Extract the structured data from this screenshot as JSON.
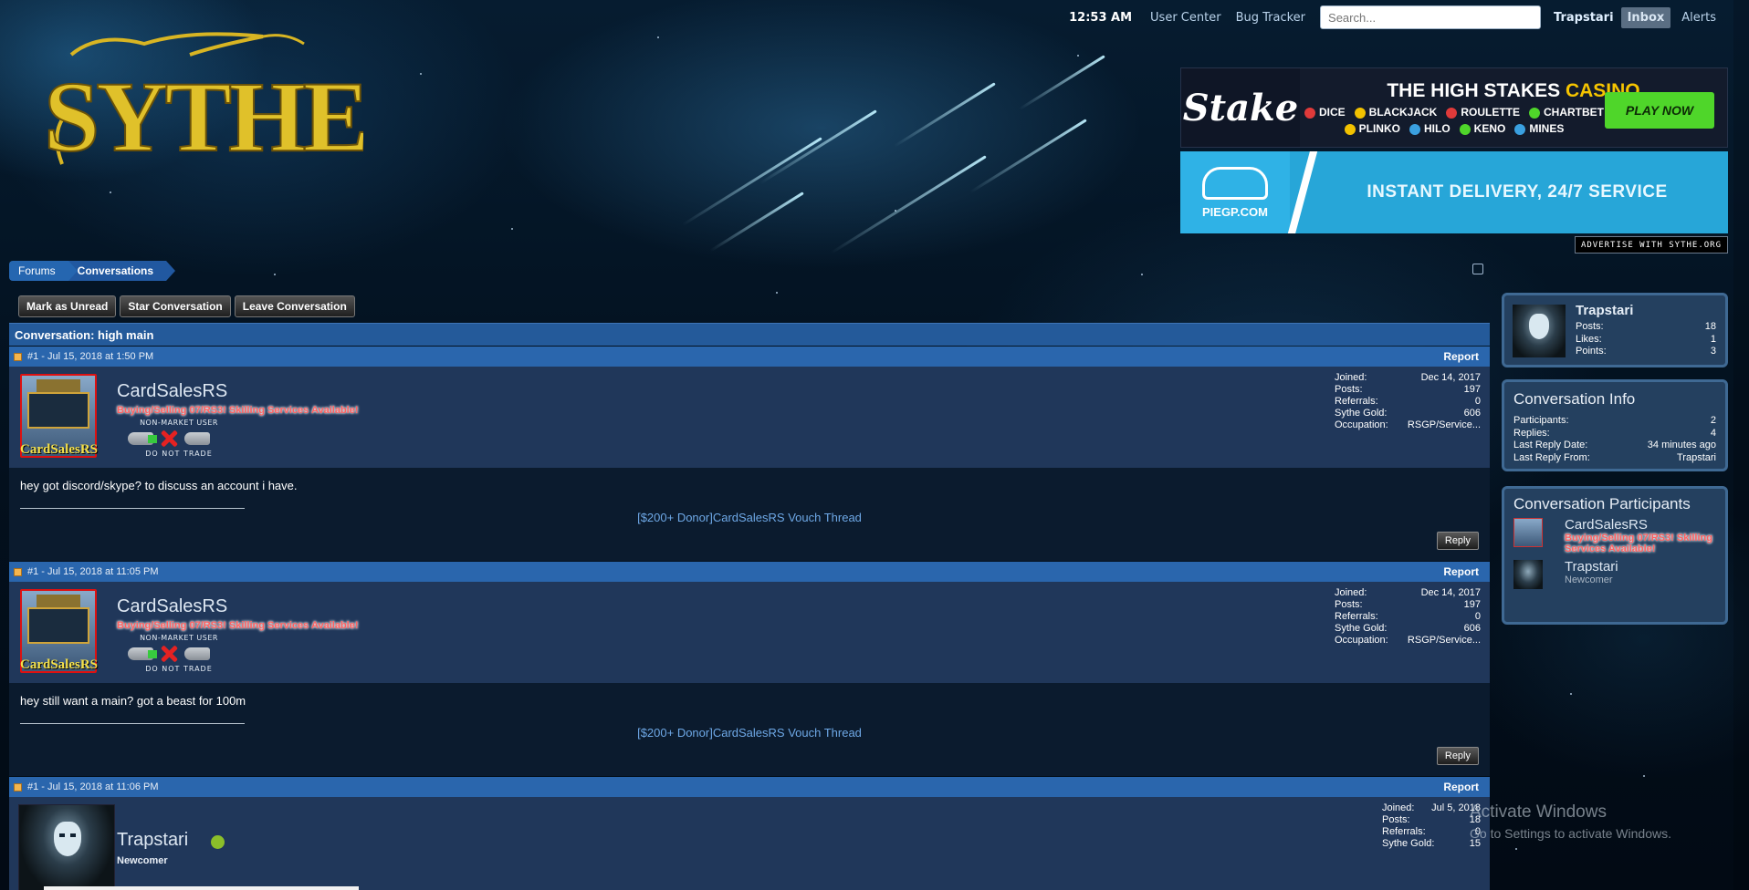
{
  "topnav": {
    "time": "12:53 AM",
    "user_center": "User Center",
    "bug_tracker": "Bug Tracker",
    "search_placeholder": "Search...",
    "username": "Trapstari",
    "inbox": "Inbox",
    "alerts": "Alerts"
  },
  "logo": {
    "text": "SYTHE",
    "color": "#e0c12a"
  },
  "ads": {
    "stake": {
      "brand": "Stake",
      "title_white": "THE HIGH STAKES",
      "title_gold": "CASINO",
      "games_row1": [
        "DICE",
        "BLACKJACK",
        "ROULETTE",
        "CHARTBET"
      ],
      "games_row2": [
        "PLINKO",
        "HILO",
        "KENO",
        "MINES"
      ],
      "cta": "PLAY NOW",
      "cta_color": "#4fd62a"
    },
    "piegp": {
      "brand": "PIEGP.COM",
      "tagline": "INSTANT DELIVERY, 24/7 SERVICE",
      "color": "#27a6d8"
    },
    "advertise": "ADVERTISE WITH SYTHE.ORG"
  },
  "breadcrumb": {
    "forums": "Forums",
    "current": "Conversations"
  },
  "actions": {
    "mark_unread": "Mark as Unread",
    "star": "Star Conversation",
    "leave": "Leave Conversation"
  },
  "conversation": {
    "title": "Conversation: high main",
    "report_label": "Report",
    "reply_label": "Reply",
    "stat_labels": {
      "joined": "Joined:",
      "posts": "Posts:",
      "referrals": "Referrals:",
      "gold": "Sythe Gold:",
      "occupation": "Occupation:"
    },
    "messages": [
      {
        "header": "#1 - Jul 15, 2018 at 1:50 PM",
        "username": "CardSalesRS",
        "user_title": "Buying/Selling 07/RS3! Skilling Services Available!",
        "badge_top": "NON-MARKET USER",
        "badge_bottom": "DO NOT TRADE",
        "avatar_text": "CardSalesRS",
        "joined": "Dec 14, 2017",
        "posts": "197",
        "referrals": "0",
        "gold": "606",
        "occupation": "RSGP/Service...",
        "text": "hey got discord/skype? to discuss an account i have.",
        "signature": "[$200+ Donor]CardSalesRS Vouch Thread"
      },
      {
        "header": "#1 - Jul 15, 2018 at 11:05 PM",
        "username": "CardSalesRS",
        "user_title": "Buying/Selling 07/RS3! Skilling Services Available!",
        "badge_top": "NON-MARKET USER",
        "badge_bottom": "DO NOT TRADE",
        "avatar_text": "CardSalesRS",
        "joined": "Dec 14, 2017",
        "posts": "197",
        "referrals": "0",
        "gold": "606",
        "occupation": "RSGP/Service...",
        "text": "hey still want a main? got a beast for 100m",
        "signature": "[$200+ Donor]CardSalesRS Vouch Thread"
      },
      {
        "header": "#1 - Jul 15, 2018 at 11:06 PM",
        "username": "Trapstari",
        "rank": "Newcomer",
        "online_color": "#8bbf2a",
        "joined": "Jul 5, 2018",
        "posts": "18",
        "referrals": "0",
        "gold": "15"
      }
    ]
  },
  "sidebar": {
    "user": {
      "name": "Trapstari",
      "posts_label": "Posts:",
      "posts": "18",
      "likes_label": "Likes:",
      "likes": "1",
      "points_label": "Points:",
      "points": "3"
    },
    "info": {
      "heading": "Conversation Info",
      "participants_label": "Participants:",
      "participants": "2",
      "replies_label": "Replies:",
      "replies": "4",
      "last_date_label": "Last Reply Date:",
      "last_date": "34 minutes ago",
      "last_from_label": "Last Reply From:",
      "last_from": "Trapstari"
    },
    "participants": {
      "heading": "Conversation Participants",
      "list": [
        {
          "name": "CardSalesRS",
          "title": "Buying/Selling 07/RS3! Skilling Services Available!"
        },
        {
          "name": "Trapstari",
          "title": "Newcomer"
        }
      ]
    }
  },
  "watermark": {
    "line1": "Activate Windows",
    "line2": "Go to Settings to activate Windows."
  }
}
